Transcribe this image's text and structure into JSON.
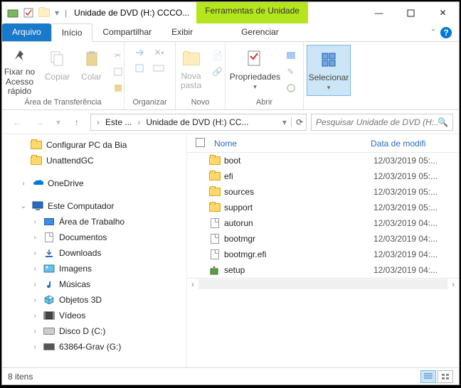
{
  "titlebar": {
    "title": "Unidade de DVD (H:) CCCO...",
    "contextual_tab": "Ferramentas de Unidade"
  },
  "tabs": {
    "file": "Arquivo",
    "home": "Início",
    "share": "Compartilhar",
    "view": "Exibir",
    "manage": "Gerenciar"
  },
  "ribbon": {
    "pin": "Fixar no Acesso rápido",
    "copy": "Copiar",
    "paste": "Colar",
    "group_clipboard": "Área de Transferência",
    "group_organize": "Organizar",
    "new_folder": "Nova pasta",
    "group_new": "Novo",
    "properties": "Propriedades",
    "group_open": "Abrir",
    "select": "Selecionar",
    "chevron": "ˇ"
  },
  "breadcrumbs": {
    "c1": "Este ...",
    "c2": "Unidade de DVD (H:) CC..."
  },
  "search": {
    "placeholder": "Pesquisar Unidade de DVD (H:..."
  },
  "tree": {
    "t0": "Configurar PC da Bia",
    "t1": "UnattendGC",
    "t2": "OneDrive",
    "t3": "Este Computador",
    "t4": "Área de Trabalho",
    "t5": "Documentos",
    "t6": "Downloads",
    "t7": "Imagens",
    "t8": "Músicas",
    "t9": "Objetos 3D",
    "t10": "Vídeos",
    "t11": "Disco D (C:)",
    "t12": "63864-Grav (G:)"
  },
  "columns": {
    "name": "Nome",
    "date": "Data de modifi"
  },
  "rows": [
    {
      "name": "boot",
      "date": "12/03/2019 05:...",
      "type": "folder"
    },
    {
      "name": "efi",
      "date": "12/03/2019 05:...",
      "type": "folder"
    },
    {
      "name": "sources",
      "date": "12/03/2019 05:...",
      "type": "folder"
    },
    {
      "name": "support",
      "date": "12/03/2019 05:...",
      "type": "folder"
    },
    {
      "name": "autorun",
      "date": "12/03/2019 04:...",
      "type": "file"
    },
    {
      "name": "bootmgr",
      "date": "12/03/2019 04:...",
      "type": "file"
    },
    {
      "name": "bootmgr.efi",
      "date": "12/03/2019 04:...",
      "type": "file"
    },
    {
      "name": "setup",
      "date": "12/03/2019 04:...",
      "type": "setup"
    }
  ],
  "status": {
    "items": "8 itens"
  }
}
